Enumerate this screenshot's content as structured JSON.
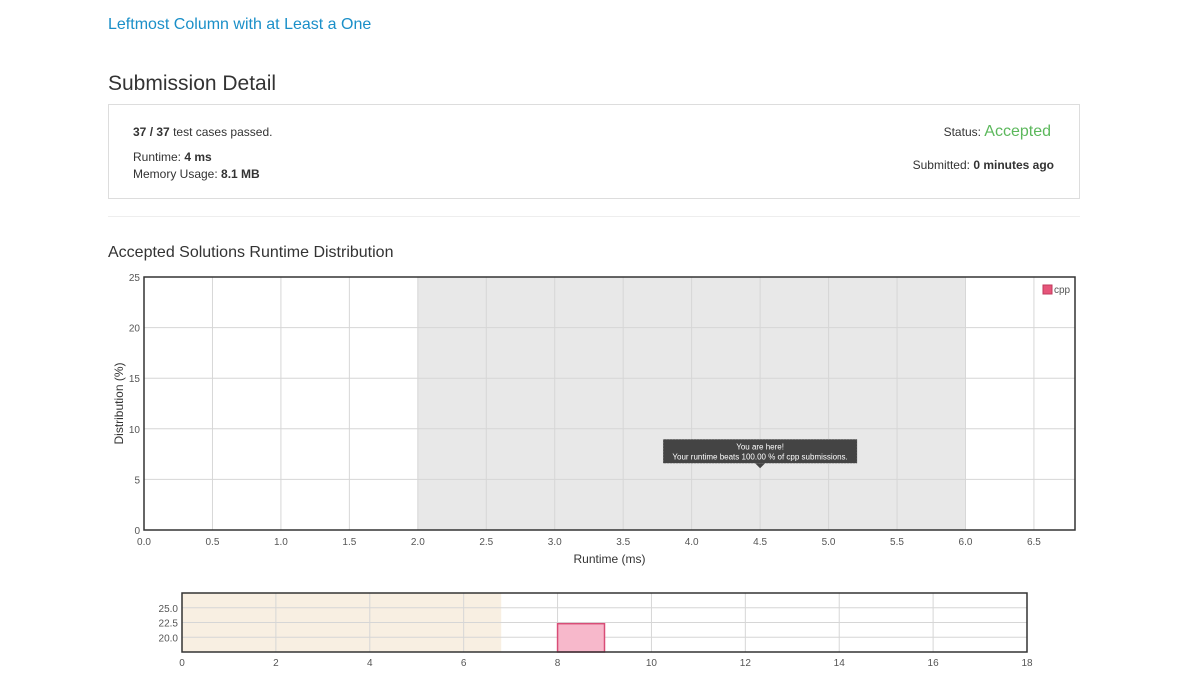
{
  "problem": {
    "title": "Leftmost Column with at Least a One"
  },
  "section": {
    "title": "Submission Detail"
  },
  "submission": {
    "cases_passed": "37",
    "cases_separator": " / ",
    "cases_total": "37",
    "cases_suffix": " test cases passed.",
    "runtime_label": "Runtime: ",
    "runtime_value": "4 ms",
    "memory_label": "Memory Usage: ",
    "memory_value": "8.1 MB",
    "status_label": "Status: ",
    "status_value": "Accepted",
    "submitted_label": "Submitted: ",
    "submitted_value": "0 minutes ago"
  },
  "colors": {
    "accent_link": "#1a8fc8",
    "accepted": "#5cb85c",
    "series": "#e6557a"
  },
  "chart_data": [
    {
      "type": "bar",
      "title": "Accepted Solutions Runtime Distribution",
      "xlabel": "Runtime (ms)",
      "ylabel": "Distribution (%)",
      "xlim": [
        0,
        6.8
      ],
      "ylim": [
        0,
        25
      ],
      "x_ticks": [
        "0.0",
        "0.5",
        "1.0",
        "1.5",
        "2.0",
        "2.5",
        "3.0",
        "3.5",
        "4.0",
        "4.5",
        "5.0",
        "5.5",
        "6.0",
        "6.5"
      ],
      "y_ticks": [
        "0",
        "5",
        "10",
        "15",
        "20",
        "25"
      ],
      "highlight_range": [
        2.0,
        6.0
      ],
      "grid": true,
      "legend": {
        "position": "top-right",
        "entries": [
          "cpp"
        ]
      },
      "series": [
        {
          "name": "cpp",
          "values": []
        }
      ],
      "tooltip": {
        "x": 4.5,
        "y": 6,
        "line1": "You are here!",
        "line2": "Your runtime beats 100.00 % of cpp submissions."
      }
    },
    {
      "type": "bar",
      "xlim": [
        0,
        18
      ],
      "ylim": [
        17.5,
        27.5
      ],
      "x_ticks": [
        "0",
        "2",
        "4",
        "6",
        "8",
        "10",
        "12",
        "14",
        "16",
        "18"
      ],
      "y_ticks": [
        "20.0",
        "22.5",
        "25.0"
      ],
      "selection_range": [
        0,
        6.8
      ],
      "grid": true,
      "bars": [
        {
          "x0": 8,
          "x1": 9,
          "value": 22.3
        }
      ]
    }
  ]
}
